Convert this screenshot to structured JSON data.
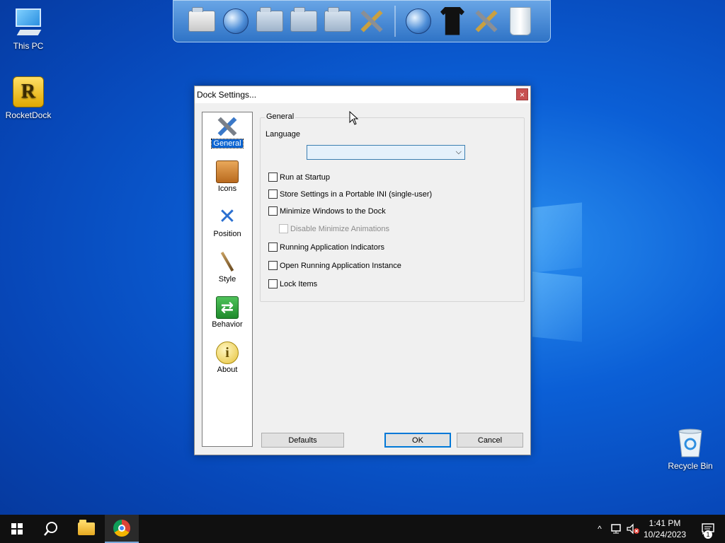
{
  "desktop": {
    "icons": [
      {
        "label": "This PC"
      },
      {
        "label": "RocketDock"
      },
      {
        "label": "Recycle Bin"
      }
    ]
  },
  "dock": {
    "items": [
      "notes-icon",
      "globe-document-icon",
      "documents-folder-icon",
      "music-folder-icon",
      "videos-folder-icon",
      "tools-folder-icon",
      "globe-icon",
      "tshirt-icon",
      "hammer-icon",
      "recycle-bin-icon"
    ]
  },
  "dialog": {
    "title": "Dock Settings...",
    "close_glyph": "×",
    "sidebar": [
      {
        "label": "General",
        "icon": "tools-icon",
        "active": true
      },
      {
        "label": "Icons",
        "icon": "box-icon",
        "active": false
      },
      {
        "label": "Position",
        "icon": "move-arrows-icon",
        "active": false
      },
      {
        "label": "Style",
        "icon": "brush-icon",
        "active": false
      },
      {
        "label": "Behavior",
        "icon": "arrows-switch-icon",
        "active": false
      },
      {
        "label": "About",
        "icon": "info-icon",
        "active": false
      }
    ],
    "group_title": "General",
    "language_label": "Language",
    "language_value": "",
    "dropdown_glyph": "⌵",
    "options": [
      {
        "label": "Run at Startup",
        "checked": false,
        "enabled": true
      },
      {
        "label": "Store Settings in a Portable INI (single-user)",
        "checked": false,
        "enabled": true
      },
      {
        "label": "Minimize Windows to the Dock",
        "checked": false,
        "enabled": true
      },
      {
        "label": "Disable Minimize Animations",
        "checked": false,
        "enabled": false
      },
      {
        "label": "Running Application Indicators",
        "checked": false,
        "enabled": true
      },
      {
        "label": "Open Running Application Instance",
        "checked": false,
        "enabled": true
      },
      {
        "label": "Lock Items",
        "checked": false,
        "enabled": true
      }
    ],
    "buttons": {
      "defaults": "Defaults",
      "ok": "OK",
      "cancel": "Cancel"
    }
  },
  "taskbar": {
    "time": "1:41 PM",
    "date": "10/24/2023",
    "notification_count": "1",
    "tray_chevron": "^"
  }
}
